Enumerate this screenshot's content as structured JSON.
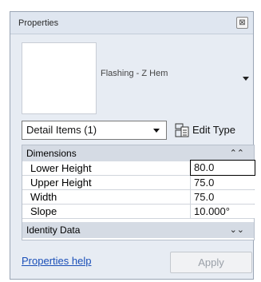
{
  "window": {
    "title": "Properties",
    "close_glyph": "⊠"
  },
  "type_selector": {
    "name": "Flashing - Z Hem"
  },
  "instance_filter": {
    "selected": "Detail Items (1)"
  },
  "edit_type": {
    "label": "Edit Type"
  },
  "groups": {
    "dimensions": {
      "label": "Dimensions",
      "chevron": "⌃⌃"
    },
    "identity": {
      "label": "Identity Data",
      "chevron": "⌄⌄"
    }
  },
  "properties": [
    {
      "name": "Lower Height",
      "value": "80.0"
    },
    {
      "name": "Upper Height",
      "value": "75.0"
    },
    {
      "name": "Width",
      "value": "75.0"
    },
    {
      "name": "Slope",
      "value": "10.000°"
    }
  ],
  "footer": {
    "help_link": "Properties help",
    "apply_label": "Apply"
  },
  "icons": {
    "close": "close-icon",
    "type_dropdown": "chevron-down-icon",
    "edit_type": "edit-type-icon",
    "collapse": "collapse-icon",
    "expand": "expand-icon"
  }
}
